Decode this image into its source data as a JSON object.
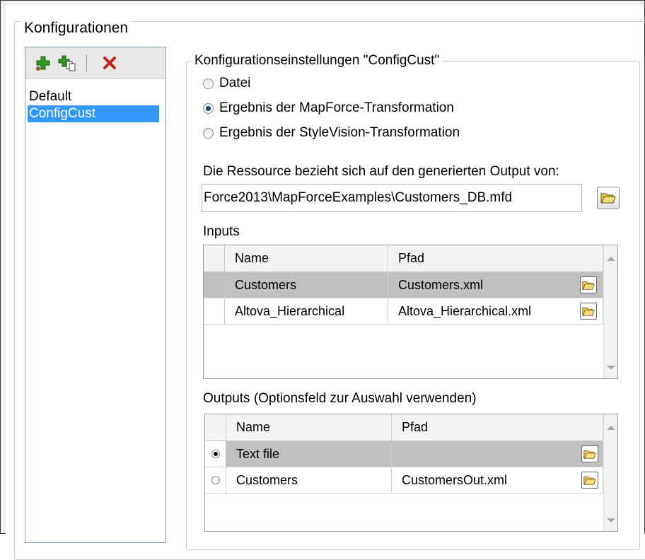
{
  "configurations": {
    "group_label": "Konfigurationen",
    "toolbar": {
      "add_icon": "add-plus-icon",
      "copy_icon": "copy-plus-icon",
      "delete_icon": "delete-x-icon"
    },
    "items": [
      {
        "label": "Default",
        "selected": false
      },
      {
        "label": "ConfigCust",
        "selected": true
      }
    ]
  },
  "settings": {
    "group_label": "Konfigurationseinstellungen \"ConfigCust\"",
    "radios": [
      {
        "label": "Datei",
        "checked": false
      },
      {
        "label": "Ergebnis der MapForce-Transformation",
        "checked": true
      },
      {
        "label": "Ergebnis der StyleVision-Transformation",
        "checked": false
      }
    ],
    "resource_label": "Die Ressource bezieht sich auf den generierten Output von:",
    "resource_path": "Force2013\\MapForceExamples\\Customers_DB.mfd",
    "inputs": {
      "label": "Inputs",
      "columns": [
        "Name",
        "Pfad"
      ],
      "rows": [
        {
          "name": "Customers",
          "path": "Customers.xml",
          "selected": true
        },
        {
          "name": "Altova_Hierarchical",
          "path": "Altova_Hierarchical.xml",
          "selected": false
        }
      ]
    },
    "outputs": {
      "label": "Outputs (Optionsfeld zur Auswahl verwenden)",
      "columns": [
        "Name",
        "Pfad"
      ],
      "rows": [
        {
          "name": "Text file",
          "path": "",
          "selected": true
        },
        {
          "name": "Customers",
          "path": "CustomersOut.xml",
          "selected": false
        }
      ]
    }
  },
  "colors": {
    "selection": "#3399ff",
    "row_selection": "#c0c0c0",
    "add_green": "#2e9a1f",
    "delete_red": "#c81e1e",
    "folder_yellow": "#f2c94c"
  }
}
